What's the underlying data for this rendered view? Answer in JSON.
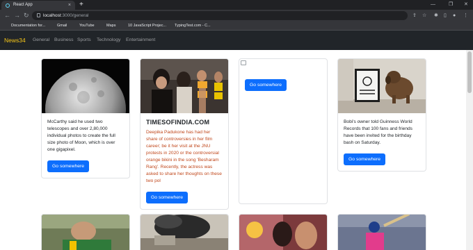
{
  "browser": {
    "tab_title": "React App",
    "tab_close": "×",
    "new_tab": "+",
    "url_host": "localhost",
    "url_path": ":3000/general",
    "icons": [
      "back-arrow-icon",
      "forward-arrow-icon",
      "reload-icon",
      "share-icon",
      "star-icon",
      "extensions-icon",
      "sidebar-icon",
      "profile-icon",
      "menu-icon"
    ]
  },
  "bookmarks": [
    {
      "label": "Documentation for...",
      "color": "#5f6368"
    },
    {
      "label": "Gmail",
      "color": "#ea4335"
    },
    {
      "label": "YouTube",
      "color": "#ff0000"
    },
    {
      "label": "Maps",
      "color": "#34a853"
    },
    {
      "label": "10 JavaScript Projec...",
      "color": "#9aa0a6"
    },
    {
      "label": "TypingTest.com - C...",
      "color": "#f28b00"
    }
  ],
  "navbar": {
    "brand": "News34",
    "links": [
      "General",
      "Business",
      "Sports",
      "Technology",
      "Entertainment"
    ]
  },
  "colors": {
    "brand": "#f5c518",
    "navbar_bg": "#212529",
    "button": "#0d6efd",
    "description_highlight": "#c0471b"
  },
  "cards": [
    {
      "image": "moon-photo",
      "title": "",
      "description": "McCarthy said he used two telescopes and over 2,80,000 individual photos to create the full size photo of Moon, which is over one gigapixel.",
      "button": "Go somewhere"
    },
    {
      "image": "crowd-photo",
      "title": "TIMESOFINDIA.COM",
      "description": "Deepika Padukone has had her share of controversies in her film career; be it her visit at the JNU protests in 2020 or the controversial orange bikini in the song 'Besharam Rang'. Recently, the actress was asked to share her thoughts on these two pol",
      "button": "Go somewhere"
    },
    {
      "image": "broken-image",
      "title": "",
      "description": "",
      "button": "Go somewhere"
    },
    {
      "image": "dog-with-certificate-photo",
      "title": "",
      "description": "Bobi's owner told Guinness World Records that 100 fans and friends have been invited for the birthday bash on Saturday.",
      "button": "Go somewhere"
    }
  ],
  "bottom_cards": [
    "cricketer-photo",
    "smoke-photo",
    "actors-photo",
    "batsman-photo"
  ]
}
